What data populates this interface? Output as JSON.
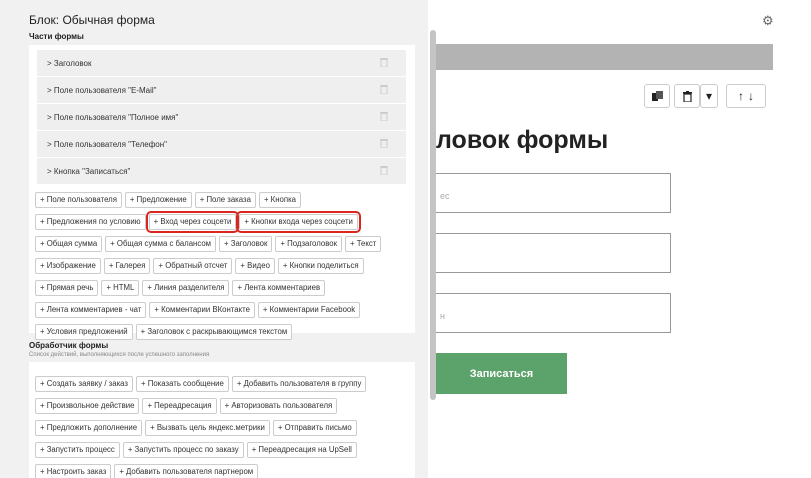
{
  "preview": {
    "heading": "ловок формы",
    "inputs": [
      "ес",
      "",
      "н"
    ],
    "submit_label": "Записаться",
    "tools": {
      "copy_icon": "copy-icon",
      "delete_icon": "trash-icon",
      "more": "▾",
      "up": "🠕",
      "down": "🠗"
    }
  },
  "panel": {
    "title": "Блок: Обычная форма",
    "parts_title": "Части формы",
    "parts": [
      "> Заголовок",
      "> Поле пользователя \"E-Mail\"",
      "> Поле пользователя \"Полное имя\"",
      "> Поле пользователя \"Телефон\"",
      "> Кнопка \"Записаться\""
    ],
    "part_buttons": [
      "+ Поле пользователя",
      "+ Предложение",
      "+ Поле заказа",
      "+ Кнопка",
      "+ Предложения по условию",
      "+ Вход через соцсети",
      "+ Кнопки входа через соцсети",
      "+ Общая сумма",
      "+ Общая сумма с балансом",
      "+ Заголовок",
      "+ Подзаголовок",
      "+ Текст",
      "+ Изображение",
      "+ Галерея",
      "+ Обратный отсчет",
      "+ Видео",
      "+ Кнопки поделиться",
      "+ Прямая речь",
      "+ HTML",
      "+ Линия разделителя",
      "+ Лента комментариев",
      "+ Лента комментариев - чат",
      "+ Комментарии ВКонтакте",
      "+ Комментарии Facebook",
      "+ Условия предложений",
      "+ Заголовок с раскрывающимся текстом"
    ],
    "handler_title": "Обработчик формы",
    "handler_subtitle": "Список действий, выполняющихся после успешного заполнения",
    "handler_buttons": [
      "+ Создать заявку / заказ",
      "+ Показать сообщение",
      "+ Добавить пользователя в группу",
      "+ Произвольное действие",
      "+ Переадресация",
      "+ Авторизовать пользователя",
      "+ Предложить дополнение",
      "+ Вызвать цель яндекс.метрики",
      "+ Отправить письмо",
      "+ Запустить процесс",
      "+ Запустить процесс по заказу",
      "+ Переадресация на UpSell",
      "+ Настроить заказ",
      "+ Добавить пользователя партнером"
    ]
  },
  "colors": {
    "highlight": "#d9271f",
    "submit": "#5ca26b",
    "panel_bg": "#f1f1f1"
  }
}
